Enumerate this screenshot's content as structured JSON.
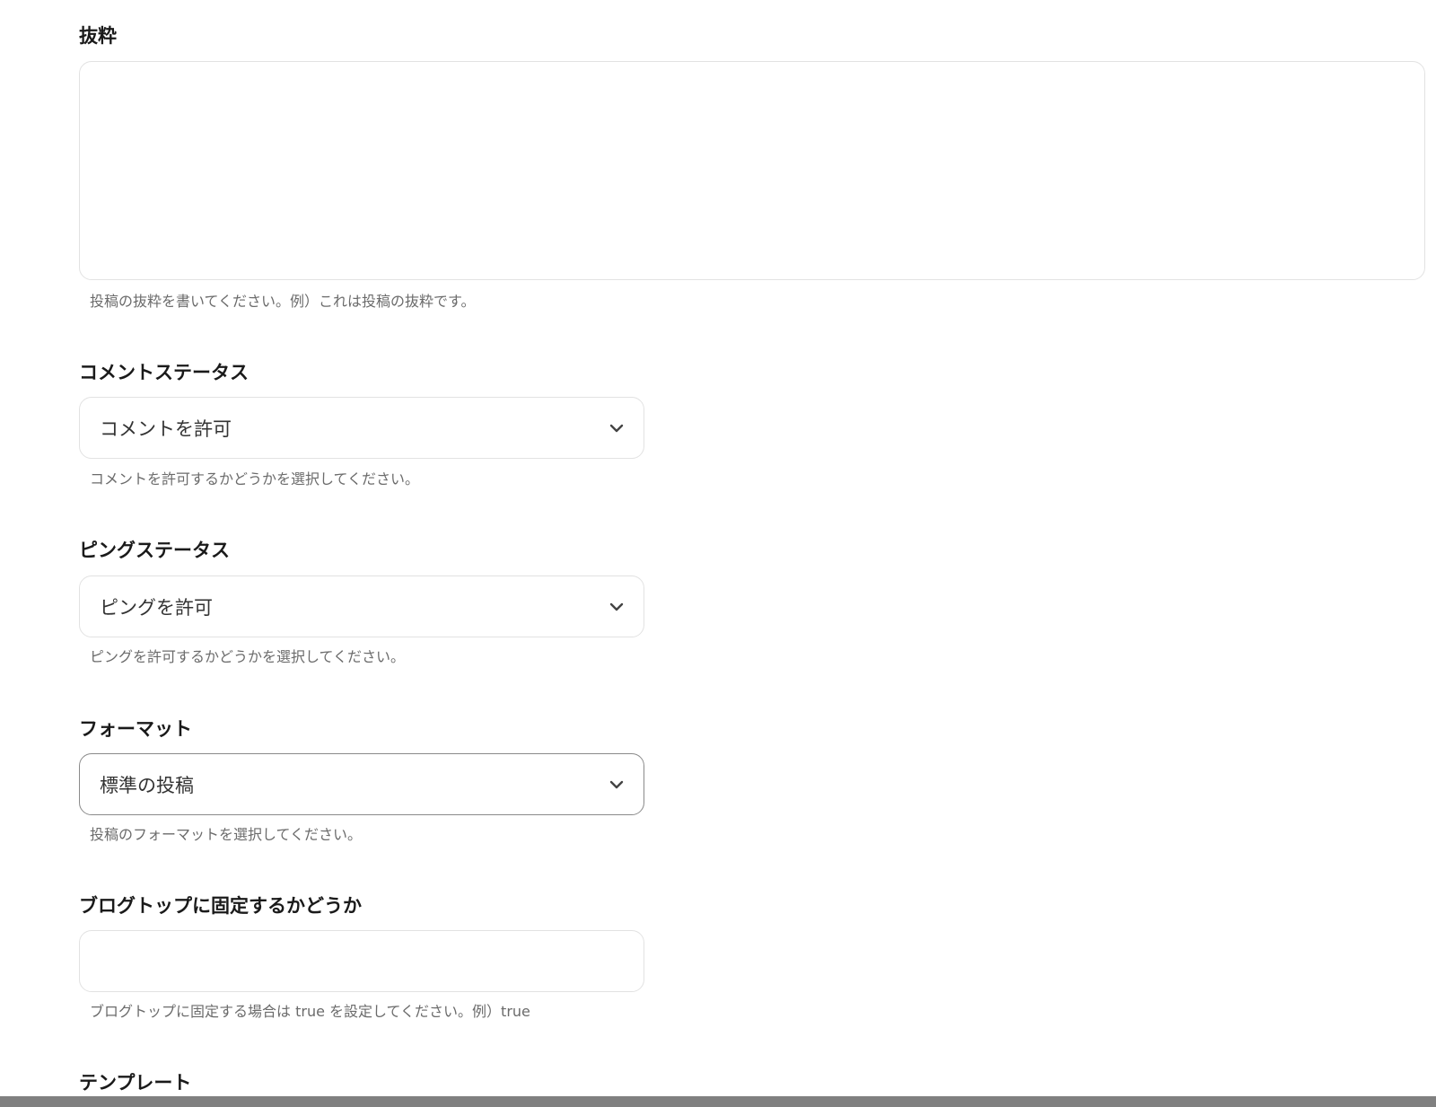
{
  "excerpt": {
    "label": "抜粋",
    "value": "",
    "help": "投稿の抜粋を書いてください。例）これは投稿の抜粋です。"
  },
  "comment_status": {
    "label": "コメントステータス",
    "value": "コメントを許可",
    "help": "コメントを許可するかどうかを選択してください。"
  },
  "ping_status": {
    "label": "ピングステータス",
    "value": "ピングを許可",
    "help": "ピングを許可するかどうかを選択してください。"
  },
  "format": {
    "label": "フォーマット",
    "value": "標準の投稿",
    "help": "投稿のフォーマットを選択してください。"
  },
  "sticky": {
    "label": "ブログトップに固定するかどうか",
    "value": "",
    "help": "ブログトップに固定する場合は true を設定してください。例）true"
  },
  "template": {
    "label": "テンプレート"
  },
  "icons": {
    "select_chevron": "chevron-down-icon"
  }
}
